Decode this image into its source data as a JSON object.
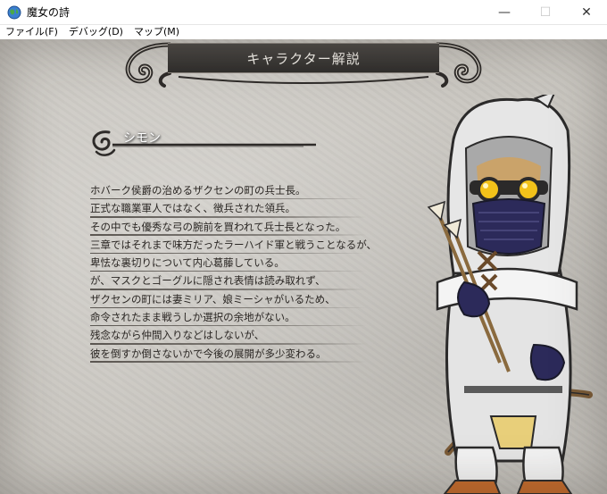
{
  "window": {
    "title": "魔女の詩",
    "minimize_glyph": "—",
    "maximize_glyph": "☐",
    "close_glyph": "✕"
  },
  "menu": {
    "items": [
      "ファイル(F)",
      "デバッグ(D)",
      "マップ(M)"
    ]
  },
  "screen": {
    "banner_title": "キャラクター解説",
    "character_name": "シモン",
    "description": [
      "ホバーク侯爵の治めるザクセンの町の兵士長。",
      "正式な職業軍人ではなく、徴兵された領兵。",
      "その中でも優秀な弓の腕前を買われて兵士長となった。",
      "三章ではそれまで味方だったラーハイド軍と戦うことなるが、",
      "卑怯な裏切りについて内心葛藤している。",
      "が、マスクとゴーグルに隠され表情は読み取れず、",
      "ザクセンの町には妻ミリア、娘ミーシャがいるため、",
      "命令されたまま戦うしか選択の余地がない。",
      "残念ながら仲間入りなどはしないが、",
      "彼を倒すか倒さないかで今後の展開が多少変わる。"
    ]
  },
  "colors": {
    "banner_bg": "#3a3735",
    "parchment": "#c9c6c0",
    "text": "#2a2623",
    "goggle_lens": "#f2c21a",
    "mask": "#2c2a5a",
    "cloak": "#e6e6e6"
  },
  "icons": {
    "app": "globe-icon",
    "name_ornament": "swirl-ornament-icon"
  }
}
